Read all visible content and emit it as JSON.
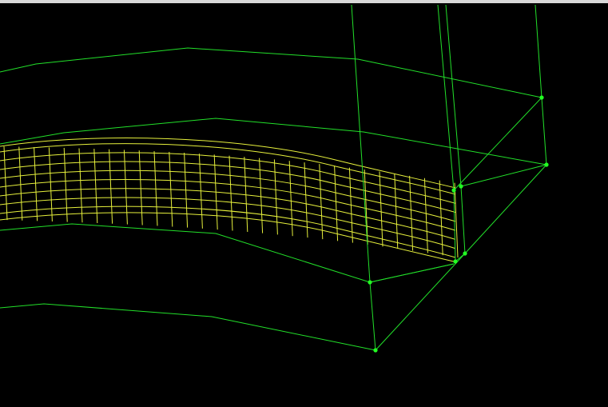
{
  "viewport": {
    "background": "#000000",
    "frame_color": "#d8d8d8"
  },
  "wireframe": {
    "edge_color": "#22e02a",
    "mesh_color": "#e6f03c",
    "vertex_color": "#22ff22"
  }
}
